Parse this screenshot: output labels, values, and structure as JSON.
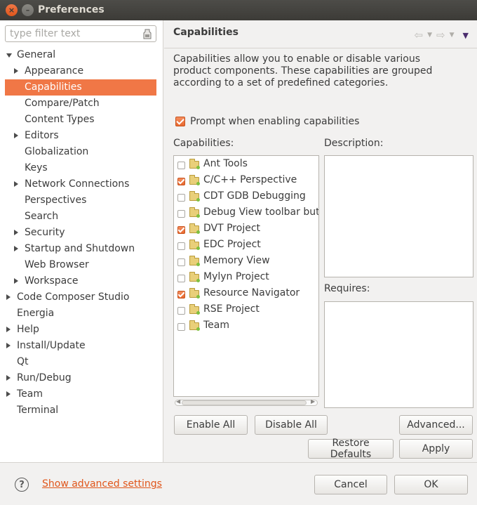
{
  "window": {
    "title": "Preferences",
    "close_glyph": "×",
    "minimize_glyph": "–"
  },
  "filter": {
    "placeholder": "type filter text",
    "icon": "clear-filter-icon"
  },
  "tree": [
    {
      "label": "General",
      "indent": 1,
      "twisty": "down",
      "selected": false
    },
    {
      "label": "Appearance",
      "indent": 2,
      "twisty": "right",
      "selected": false
    },
    {
      "label": "Capabilities",
      "indent": 2,
      "twisty": "",
      "selected": true
    },
    {
      "label": "Compare/Patch",
      "indent": 2,
      "twisty": "",
      "selected": false
    },
    {
      "label": "Content Types",
      "indent": 2,
      "twisty": "",
      "selected": false
    },
    {
      "label": "Editors",
      "indent": 2,
      "twisty": "right",
      "selected": false
    },
    {
      "label": "Globalization",
      "indent": 2,
      "twisty": "",
      "selected": false
    },
    {
      "label": "Keys",
      "indent": 2,
      "twisty": "",
      "selected": false
    },
    {
      "label": "Network Connections",
      "indent": 2,
      "twisty": "right",
      "selected": false
    },
    {
      "label": "Perspectives",
      "indent": 2,
      "twisty": "",
      "selected": false
    },
    {
      "label": "Search",
      "indent": 2,
      "twisty": "",
      "selected": false
    },
    {
      "label": "Security",
      "indent": 2,
      "twisty": "right",
      "selected": false
    },
    {
      "label": "Startup and Shutdown",
      "indent": 2,
      "twisty": "right",
      "selected": false
    },
    {
      "label": "Web Browser",
      "indent": 2,
      "twisty": "",
      "selected": false
    },
    {
      "label": "Workspace",
      "indent": 2,
      "twisty": "right",
      "selected": false
    },
    {
      "label": "Code Composer Studio",
      "indent": 1,
      "twisty": "right",
      "selected": false
    },
    {
      "label": "Energia",
      "indent": 1,
      "twisty": "",
      "selected": false
    },
    {
      "label": "Help",
      "indent": 1,
      "twisty": "right",
      "selected": false
    },
    {
      "label": "Install/Update",
      "indent": 1,
      "twisty": "right",
      "selected": false
    },
    {
      "label": "Qt",
      "indent": 1,
      "twisty": "",
      "selected": false
    },
    {
      "label": "Run/Debug",
      "indent": 1,
      "twisty": "right",
      "selected": false
    },
    {
      "label": "Team",
      "indent": 1,
      "twisty": "right",
      "selected": false
    },
    {
      "label": "Terminal",
      "indent": 1,
      "twisty": "",
      "selected": false
    }
  ],
  "page": {
    "title": "Capabilities",
    "nav": {
      "back_glyph": "⇦",
      "forward_glyph": "⇨",
      "dropdown_glyph": "▼",
      "menu_glyph": "▼"
    },
    "description": "Capabilities allow you to enable or disable various product components. These capabilities are grouped according to a set of predefined categories.",
    "prompt_label": "Prompt when enabling capabilities",
    "prompt_checked": true,
    "capabilities_label": "Capabilities:",
    "description_label": "Description:",
    "requires_label": "Requires:",
    "capabilities": [
      {
        "label": "Ant Tools",
        "checked": false
      },
      {
        "label": "C/C++ Perspective",
        "checked": true
      },
      {
        "label": "CDT GDB Debugging",
        "checked": false
      },
      {
        "label": "Debug View toolbar butt",
        "checked": false
      },
      {
        "label": "DVT Project",
        "checked": true
      },
      {
        "label": "EDC Project",
        "checked": false
      },
      {
        "label": "Memory View",
        "checked": false
      },
      {
        "label": "Mylyn Project",
        "checked": false
      },
      {
        "label": "Resource Navigator",
        "checked": true
      },
      {
        "label": "RSE Project",
        "checked": false
      },
      {
        "label": "Team",
        "checked": false
      }
    ],
    "scroll_left_glyph": "◀",
    "scroll_right_glyph": "▶",
    "buttons": {
      "enable_all": "Enable All",
      "disable_all": "Disable All",
      "advanced": "Advanced...",
      "restore_defaults": "Restore Defaults",
      "apply": "Apply"
    }
  },
  "footer": {
    "help_glyph": "?",
    "advanced_link": "Show advanced settings",
    "cancel": "Cancel",
    "ok": "OK"
  },
  "colors": {
    "accent": "#f07746",
    "link": "#e0561b",
    "titlebar": "#3c3b37"
  }
}
